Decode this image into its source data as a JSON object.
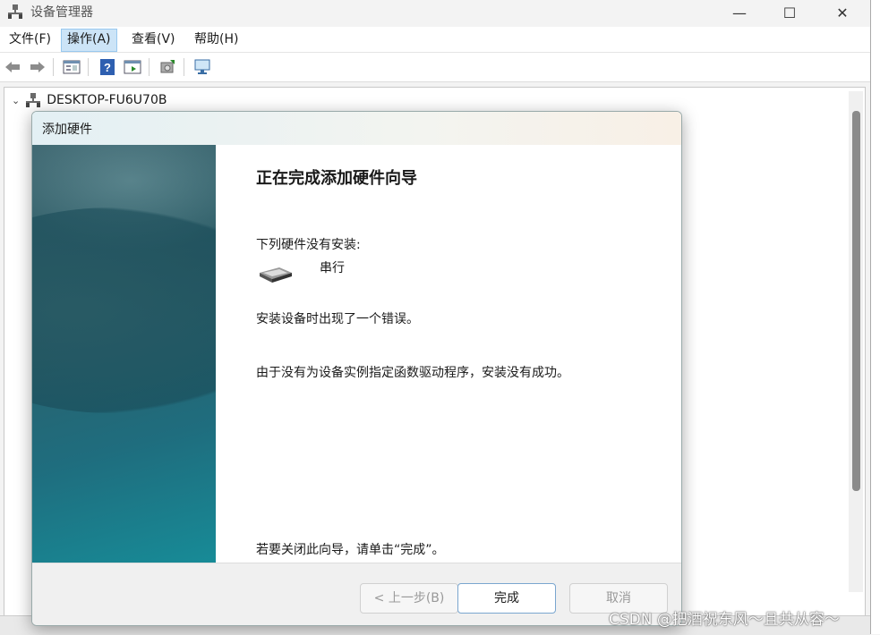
{
  "window": {
    "title": "设备管理器",
    "controls": {
      "minimize": "—",
      "maximize": "☐",
      "close": "✕"
    }
  },
  "menu": [
    "文件(F)",
    "操作(A)",
    "查看(V)",
    "帮助(H)"
  ],
  "toolbar": {
    "icons": [
      "back-icon",
      "forward-icon",
      "properties-icon",
      "help-icon",
      "show-hide-icon",
      "update-driver-icon",
      "scan-hardware-icon"
    ]
  },
  "tree": {
    "root": "DESKTOP-FU6U70B"
  },
  "dialog": {
    "title": "添加硬件",
    "heading": "正在完成添加硬件向导",
    "not_installed": "下列硬件没有安装:",
    "device_name": "串行",
    "error": "安装设备时出现了一个错误。",
    "reason": "由于没有为设备实例指定函数驱动程序，安装没有成功。",
    "close_hint": "若要关闭此向导，请单击“完成”。",
    "buttons": {
      "back": "< 上一步(B)",
      "finish": "完成",
      "cancel": "取消"
    }
  },
  "watermark": "CSDN @把酒祝东风～且共从容～",
  "colors": {
    "menu_active": "#cce4f7",
    "banner_teal": "#1f6d7e"
  }
}
